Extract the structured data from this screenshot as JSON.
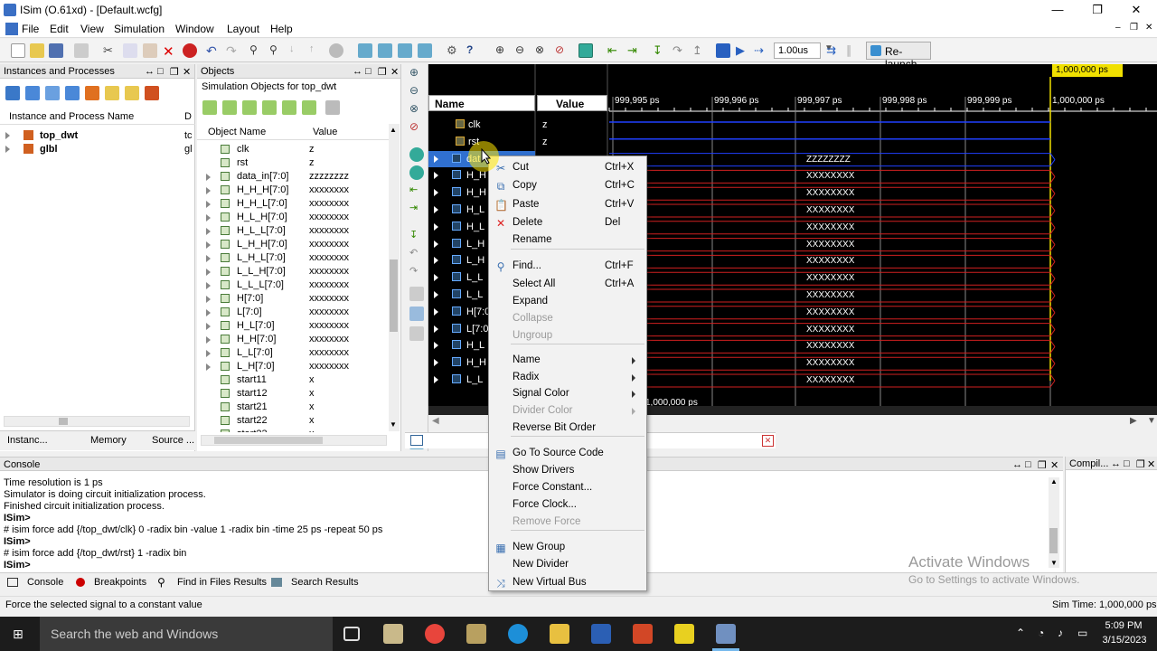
{
  "window": {
    "title": "ISim (O.61xd) - [Default.wcfg]",
    "minimize": "—",
    "maximize": "❐",
    "close": "✕"
  },
  "menu": [
    "File",
    "Edit",
    "View",
    "Simulation",
    "Window",
    "Layout",
    "Help"
  ],
  "toolbar": {
    "time_value": "1.00us",
    "relaunch_label": "Re-launch"
  },
  "instances_panel": {
    "title": "Instances and Processes",
    "column_name": "Instance and Process Name",
    "column_second": "D",
    "rows": [
      {
        "name": "top_dwt",
        "second": "tc"
      },
      {
        "name": "glbl",
        "second": "gl"
      }
    ],
    "tabs": [
      "Instanc...",
      "Memory",
      "Source ..."
    ]
  },
  "objects_panel": {
    "title": "Objects",
    "subtitle": "Simulation Objects for top_dwt",
    "column_name": "Object Name",
    "column_value": "Value",
    "rows": [
      {
        "name": "clk",
        "value": "z",
        "expand": false
      },
      {
        "name": "rst",
        "value": "z",
        "expand": false
      },
      {
        "name": "data_in[7:0]",
        "value": "zzzzzzzz",
        "expand": true
      },
      {
        "name": "H_H_H[7:0]",
        "value": "xxxxxxxx",
        "expand": true
      },
      {
        "name": "H_H_L[7:0]",
        "value": "xxxxxxxx",
        "expand": true
      },
      {
        "name": "H_L_H[7:0]",
        "value": "xxxxxxxx",
        "expand": true
      },
      {
        "name": "H_L_L[7:0]",
        "value": "xxxxxxxx",
        "expand": true
      },
      {
        "name": "L_H_H[7:0]",
        "value": "xxxxxxxx",
        "expand": true
      },
      {
        "name": "L_H_L[7:0]",
        "value": "xxxxxxxx",
        "expand": true
      },
      {
        "name": "L_L_H[7:0]",
        "value": "xxxxxxxx",
        "expand": true
      },
      {
        "name": "L_L_L[7:0]",
        "value": "xxxxxxxx",
        "expand": true
      },
      {
        "name": "H[7:0]",
        "value": "xxxxxxxx",
        "expand": true
      },
      {
        "name": "L[7:0]",
        "value": "xxxxxxxx",
        "expand": true
      },
      {
        "name": "H_L[7:0]",
        "value": "xxxxxxxx",
        "expand": true
      },
      {
        "name": "H_H[7:0]",
        "value": "xxxxxxxx",
        "expand": true
      },
      {
        "name": "L_L[7:0]",
        "value": "xxxxxxxx",
        "expand": true
      },
      {
        "name": "L_H[7:0]",
        "value": "xxxxxxxx",
        "expand": true
      },
      {
        "name": "start11",
        "value": "x",
        "expand": false
      },
      {
        "name": "start12",
        "value": "x",
        "expand": false
      },
      {
        "name": "start21",
        "value": "x",
        "expand": false
      },
      {
        "name": "start22",
        "value": "x",
        "expand": false
      },
      {
        "name": "start23",
        "value": "x",
        "expand": false
      }
    ]
  },
  "wave": {
    "name_header": "Name",
    "value_header": "Value",
    "cursor_label": "1,000,000 ps",
    "bottom_label": "1,000,000 ps",
    "ticks": [
      "999,995 ps",
      "999,996 ps",
      "999,997 ps",
      "999,998 ps",
      "999,999 ps",
      "1,000,000 ps"
    ],
    "rows": [
      {
        "name": "clk",
        "value": "z",
        "wave": ""
      },
      {
        "name": "rst",
        "value": "z",
        "wave": ""
      },
      {
        "name": "data_in[7:0]",
        "value": "zzzzzzzz",
        "wave": "ZZZZZZZZ"
      },
      {
        "name": "H_H_H[7:0]",
        "value": "",
        "wave": "XXXXXXXX"
      },
      {
        "name": "H_H_L[7:0]",
        "value": "",
        "wave": "XXXXXXXX"
      },
      {
        "name": "H_L_H[7:0]",
        "value": "",
        "wave": "XXXXXXXX"
      },
      {
        "name": "H_L_L[7:0]",
        "value": "",
        "wave": "XXXXXXXX"
      },
      {
        "name": "L_H_H[7:0]",
        "value": "",
        "wave": "XXXXXXXX"
      },
      {
        "name": "L_H_L[7:0]",
        "value": "",
        "wave": "XXXXXXXX"
      },
      {
        "name": "L_L_H[7:0]",
        "value": "",
        "wave": "XXXXXXXX"
      },
      {
        "name": "L_L_L[7:0]",
        "value": "",
        "wave": "XXXXXXXX"
      },
      {
        "name": "H[7:0]",
        "value": "",
        "wave": "XXXXXXXX"
      },
      {
        "name": "L[7:0]",
        "value": "",
        "wave": "XXXXXXXX"
      },
      {
        "name": "H_L[7:0]",
        "value": "",
        "wave": "XXXXXXXX"
      },
      {
        "name": "H_H[7:0]",
        "value": "",
        "wave": "XXXXXXXX"
      },
      {
        "name": "L_L[7:0]",
        "value": "",
        "wave": "XXXXXXXX"
      }
    ],
    "visible_names": [
      "clk",
      "rst",
      "dat",
      "H_H",
      "H_H",
      "H_L",
      "H_L",
      "L_H",
      "L_H",
      "L_L",
      "L_L",
      "H[7:0",
      "L[7:0]",
      "H_L",
      "H_H",
      "L_L"
    ]
  },
  "context_menu": {
    "items": [
      {
        "label": "Cut",
        "shortcut": "Ctrl+X",
        "icon": "scissors-icon",
        "glyph": "✂"
      },
      {
        "label": "Copy",
        "shortcut": "Ctrl+C",
        "icon": "copy-icon",
        "glyph": "⧉"
      },
      {
        "label": "Paste",
        "shortcut": "Ctrl+V",
        "icon": "paste-icon",
        "glyph": "📋"
      },
      {
        "label": "Delete",
        "shortcut": "Del",
        "icon": "delete-icon",
        "glyph": "✕"
      },
      {
        "label": "Rename",
        "shortcut": ""
      },
      {
        "label": "Find...",
        "shortcut": "Ctrl+F",
        "icon": "binoculars-icon",
        "glyph": "⚲"
      },
      {
        "label": "Select All",
        "shortcut": "Ctrl+A"
      },
      {
        "label": "Expand",
        "shortcut": ""
      },
      {
        "label": "Collapse",
        "shortcut": "",
        "disabled": true
      },
      {
        "label": "Ungroup",
        "shortcut": "",
        "disabled": true
      },
      {
        "label": "Name",
        "submenu": true
      },
      {
        "label": "Radix",
        "submenu": true
      },
      {
        "label": "Signal Color",
        "submenu": true
      },
      {
        "label": "Divider Color",
        "submenu": true,
        "disabled": true
      },
      {
        "label": "Reverse Bit Order"
      },
      {
        "label": "Go To Source Code",
        "icon": "source-code-icon",
        "glyph": "▤"
      },
      {
        "label": "Show Drivers"
      },
      {
        "label": "Force Constant..."
      },
      {
        "label": "Force Clock..."
      },
      {
        "label": "Remove Force",
        "disabled": true
      },
      {
        "label": "New Group",
        "icon": "group-icon",
        "glyph": "▦"
      },
      {
        "label": "New Divider"
      },
      {
        "label": "New Virtual Bus",
        "icon": "virtual-bus-icon",
        "glyph": "⤨"
      }
    ]
  },
  "console": {
    "title": "Console",
    "lines": [
      "Time resolution is 1 ps",
      "Simulator is doing circuit initialization process.",
      "Finished circuit initialization process.",
      "ISim>",
      "# isim force add {/top_dwt/clk} 0 -radix bin -value 1 -radix bin -time 25 ps -repeat 50 ps",
      "ISim>",
      "# isim force add {/top_dwt/rst} 1 -radix bin",
      "ISim>"
    ],
    "compil_title": "Compil...",
    "tabs": [
      "Console",
      "Breakpoints",
      "Find in Files Results",
      "Search Results"
    ]
  },
  "status": {
    "message": "Force the selected signal to a constant value",
    "sim_time": "Sim Time: 1,000,000 ps"
  },
  "watermark": {
    "line1": "Activate Windows",
    "line2": "Go to Settings to activate Windows."
  },
  "taskbar": {
    "search_placeholder": "Search the web and Windows",
    "time": "5:09 PM",
    "date": "3/15/2023"
  },
  "colors": {
    "wave_bg": "#000000",
    "wave_blue": "#2040ff",
    "wave_red": "#d02020",
    "cursor_yellow": "#f0e000",
    "selection": "#3070d0"
  }
}
